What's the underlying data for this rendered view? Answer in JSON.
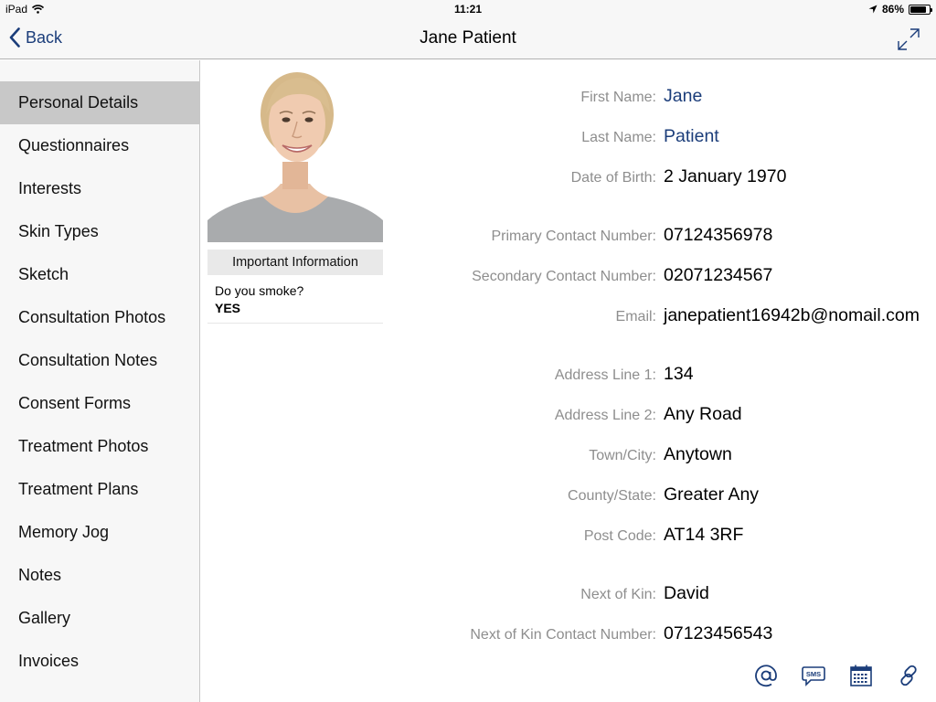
{
  "status_bar": {
    "device": "iPad",
    "time": "11:21",
    "battery_percent": "86%",
    "battery_level": 0.86
  },
  "nav": {
    "back_label": "Back",
    "title": "Jane Patient"
  },
  "sidebar": {
    "items": [
      {
        "label": "Personal Details",
        "active": true
      },
      {
        "label": "Questionnaires"
      },
      {
        "label": "Interests"
      },
      {
        "label": "Skin Types"
      },
      {
        "label": "Sketch"
      },
      {
        "label": "Consultation Photos"
      },
      {
        "label": "Consultation Notes"
      },
      {
        "label": "Consent Forms"
      },
      {
        "label": "Treatment Photos"
      },
      {
        "label": "Treatment Plans"
      },
      {
        "label": "Memory Jog"
      },
      {
        "label": "Notes"
      },
      {
        "label": "Gallery"
      },
      {
        "label": "Invoices"
      }
    ]
  },
  "important": {
    "header": "Important Information",
    "question": "Do you smoke?",
    "answer": "YES"
  },
  "details": {
    "first_name": {
      "label": "First Name:",
      "value": "Jane"
    },
    "last_name": {
      "label": "Last Name:",
      "value": "Patient"
    },
    "dob": {
      "label": "Date of Birth:",
      "value": "2 January 1970"
    },
    "primary_contact": {
      "label": "Primary Contact Number:",
      "value": "07124356978"
    },
    "secondary_contact": {
      "label": "Secondary Contact Number:",
      "value": "02071234567"
    },
    "email": {
      "label": "Email:",
      "value": "janepatient16942b@nomail.com"
    },
    "address1": {
      "label": "Address Line 1:",
      "value": "134"
    },
    "address2": {
      "label": "Address Line 2:",
      "value": "Any Road"
    },
    "town": {
      "label": "Town/City:",
      "value": "Anytown"
    },
    "county": {
      "label": "County/State:",
      "value": "Greater Any"
    },
    "postcode": {
      "label": "Post Code:",
      "value": "AT14 3RF"
    },
    "next_of_kin": {
      "label": "Next of Kin:",
      "value": "David"
    },
    "kin_contact": {
      "label": "Next of Kin Contact Number:",
      "value": "07123456543"
    }
  },
  "toolbar": {
    "sms_label": "SMS",
    "icons": [
      "at-sign-icon",
      "sms-icon",
      "calendar-icon",
      "link-icon"
    ]
  },
  "colors": {
    "accent": "#1b3d7a",
    "label_gray": "#8e8e8e",
    "sidebar_bg": "#f7f7f7",
    "sidebar_active": "#c8c8c8"
  }
}
